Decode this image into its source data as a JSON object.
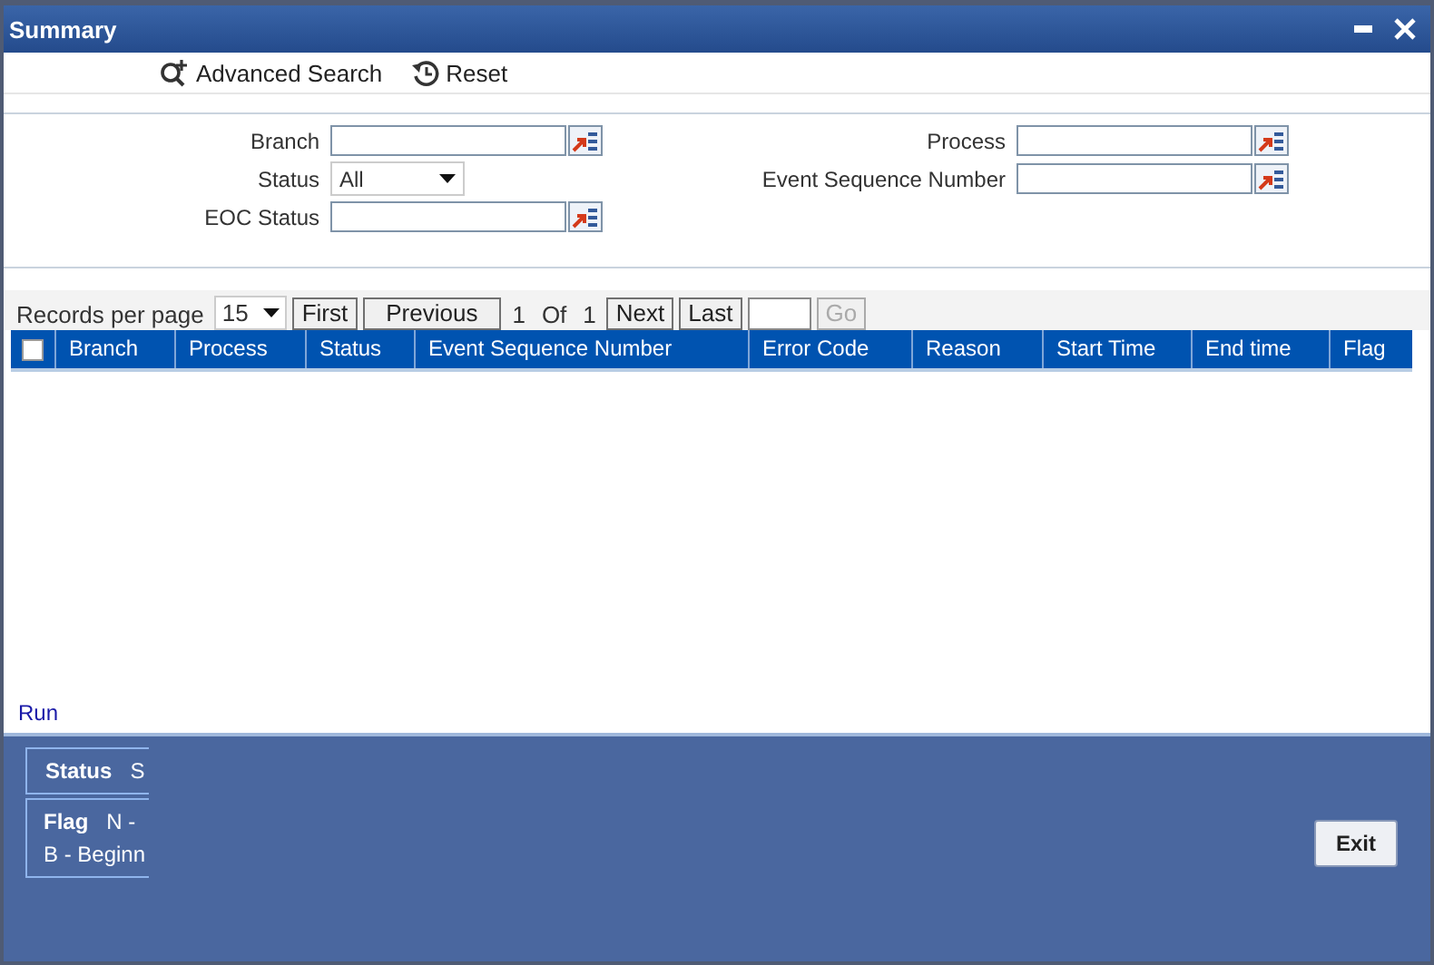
{
  "window": {
    "title": "Summary"
  },
  "toolbar": [
    {
      "kind": "advanced",
      "label": "Advanced Search"
    },
    {
      "kind": "reset",
      "label": "Reset"
    }
  ],
  "form_left": [
    {
      "kind": "lov",
      "label": "Branch"
    },
    {
      "kind": "select",
      "label": "Status",
      "value": "All"
    },
    {
      "kind": "lov",
      "label": "EOC Status"
    }
  ],
  "form_right": [
    {
      "kind": "lov",
      "label": "Process"
    },
    {
      "kind": "lov",
      "label": "Event Sequence Number"
    }
  ],
  "pagination": {
    "records_label": "Records per page",
    "per_page": "15",
    "first": "First",
    "previous": "Previous",
    "page": "1",
    "of": "Of",
    "total": "1",
    "next": "Next",
    "last": "Last",
    "go": "Go"
  },
  "table": {
    "select_all_checked": false,
    "columns": [
      "Branch",
      "Process",
      "Status",
      "Event Sequence Number",
      "Error Code",
      "Reason",
      "Start Time",
      "End time",
      "Flag"
    ]
  },
  "run_link": "Run",
  "legend": {
    "status_label": "Status",
    "status_text": "S",
    "flag_label": "Flag",
    "flag_text": "N -",
    "flag_line2": "B - Beginn"
  },
  "exit_button": "Exit"
}
